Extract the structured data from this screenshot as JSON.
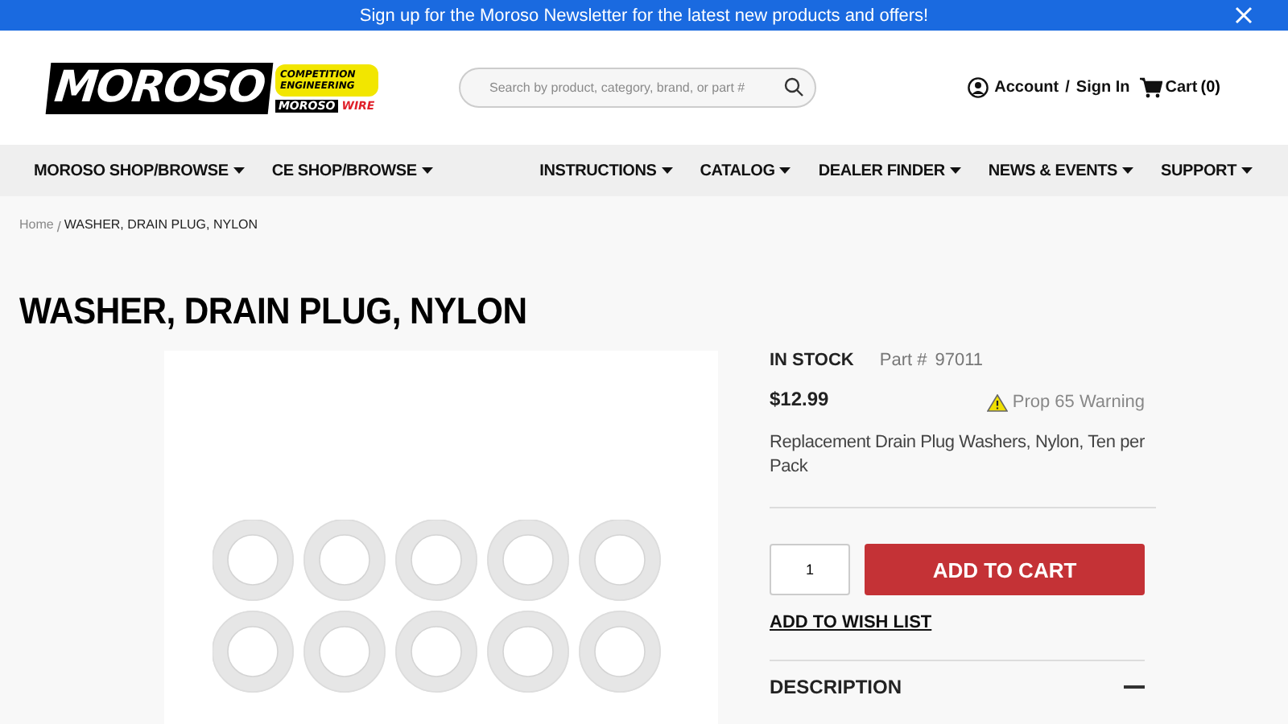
{
  "banner": {
    "text": "Sign up for the Moroso Newsletter for the latest new products and offers!"
  },
  "logo": {
    "brand": "MOROSO",
    "partner": "COMPETITION ENGINEERING",
    "sub_brand": "MOROSO",
    "sub_brand_2": "WIRE"
  },
  "search": {
    "placeholder": "Search by product, category, brand, or part #"
  },
  "account": {
    "label": "Account",
    "separator": "/",
    "sign_in": "Sign In"
  },
  "cart": {
    "label": "Cart",
    "count": "(0)"
  },
  "nav_left": [
    "MOROSO SHOP/BROWSE",
    "CE SHOP/BROWSE"
  ],
  "nav_right": [
    "INSTRUCTIONS",
    "CATALOG",
    "DEALER FINDER",
    "NEWS & EVENTS",
    "SUPPORT"
  ],
  "breadcrumb": [
    {
      "label": "Home",
      "current": false
    },
    {
      "label": "WASHER, DRAIN PLUG, NYLON",
      "current": true
    }
  ],
  "breadcrumb_separator": "/",
  "product": {
    "title": "WASHER, DRAIN PLUG, NYLON",
    "stock": "IN STOCK",
    "part_label": "Part #",
    "part_number": "97011",
    "price": "$12.99",
    "warning": "Prop 65 Warning",
    "summary": "Replacement Drain Plug Washers, Nylon, Ten per Pack",
    "quantity": "1",
    "add_to_cart": "ADD TO CART",
    "wish_list": "ADD TO WISH LIST"
  },
  "accordion": [
    {
      "label": "DESCRIPTION",
      "expanded": true
    }
  ]
}
